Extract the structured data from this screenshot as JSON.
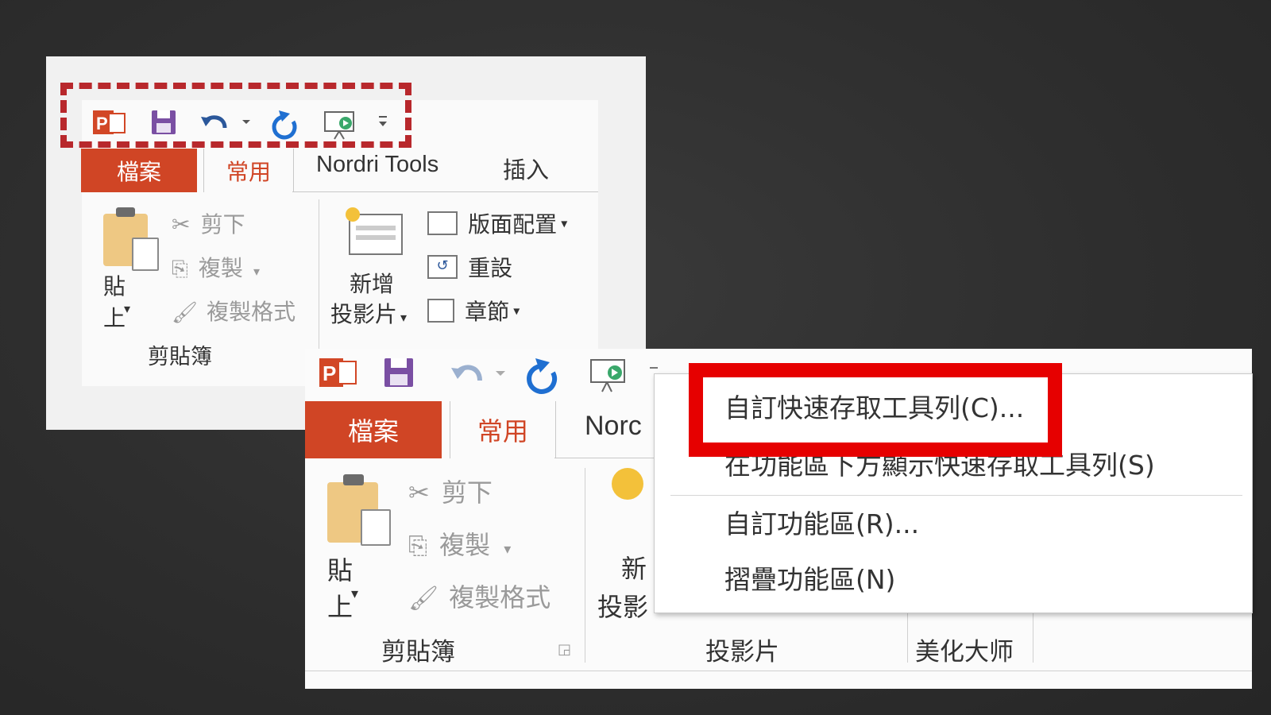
{
  "panel_back": {
    "tabs": {
      "file": "檔案",
      "home": "常用",
      "nordri": "Nordri Tools",
      "insert": "插入"
    },
    "clipboard": {
      "paste": "貼上",
      "cut": "剪下",
      "copy": "複製",
      "format_painter": "複製格式",
      "group_label": "剪貼簿"
    },
    "slides": {
      "new_slide_line1": "新增",
      "new_slide_line2": "投影片",
      "layout": "版面配置",
      "reset": "重設",
      "section": "章節"
    }
  },
  "panel_front": {
    "tabs": {
      "file": "檔案",
      "home": "常用",
      "nordri_partial": "Norc"
    },
    "clipboard": {
      "paste": "貼上",
      "cut": "剪下",
      "copy": "複製",
      "format_painter": "複製格式",
      "group_label": "剪貼簿"
    },
    "slides": {
      "new_slide_partial_top": "新",
      "new_slide_partial_bottom": "投影",
      "group_label": "投影片"
    },
    "beautify": {
      "group_label": "美化大师"
    }
  },
  "context_menu": {
    "items": [
      "自訂快速存取工具列(C)...",
      "在功能區下方顯示快速存取工具列(S)",
      "自訂功能區(R)...",
      "摺疊功能區(N)"
    ]
  },
  "colors": {
    "office_red": "#d04525",
    "highlight_red": "#e60000",
    "dashed_red": "#b8282c",
    "save_purple": "#7a4fa3",
    "undo_blue": "#2b579a",
    "redo_blue": "#1f6fd1"
  },
  "icons": {
    "qat": [
      "powerpoint-logo-icon",
      "save-icon",
      "undo-icon",
      "redo-icon",
      "presentation-icon",
      "qat-dropdown-icon"
    ]
  }
}
